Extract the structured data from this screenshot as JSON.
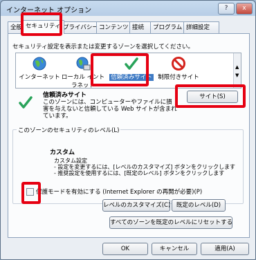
{
  "window": {
    "title": "インターネット オプション",
    "help_glyph": "?",
    "close_glyph": "x"
  },
  "tabs": [
    "全般",
    "セキュリティ",
    "プライバシー",
    "コンテンツ",
    "接続",
    "プログラム",
    "詳細設定"
  ],
  "security": {
    "instruction": "セキュリティ設定を表示または変更するゾーンを選択してください。",
    "zones": [
      "インターネット",
      "ローカル イントラネット",
      "信頼済みサイト",
      "制限付きサイト"
    ],
    "selected_zone": "信頼済みサイト",
    "zone_title": "信頼済みサイト",
    "zone_description": "このゾーンには、コンピューターやファイルに損害を与えないと信頼している Web サイトが含まれています。",
    "sites_button": "サイト(S)",
    "level_group_title": "このゾーンのセキュリティのレベル(L)",
    "level_name": "カスタム",
    "level_detail_1": "カスタム設定",
    "level_detail_2": "- 設定を変更するには、[レベルのカスタマイズ] ボタンをクリックします",
    "level_detail_3": "- 推奨設定を使用するには、[既定のレベル] ボタンをクリックします",
    "protected_mode_label": "保護モードを有効にする (Internet Explorer の再開が必要)(P)",
    "protected_mode_checked": false,
    "customize_button": "レベルのカスタマイズ(C)...",
    "default_button": "既定のレベル(D)",
    "reset_all_button": "すべてのゾーンを既定のレベルにリセットする(R)"
  },
  "footer": {
    "ok": "OK",
    "cancel": "キャンセル",
    "apply": "適用(A)"
  },
  "colors": {
    "highlight_box": "#e60012",
    "selection": "#3e7ac4"
  }
}
